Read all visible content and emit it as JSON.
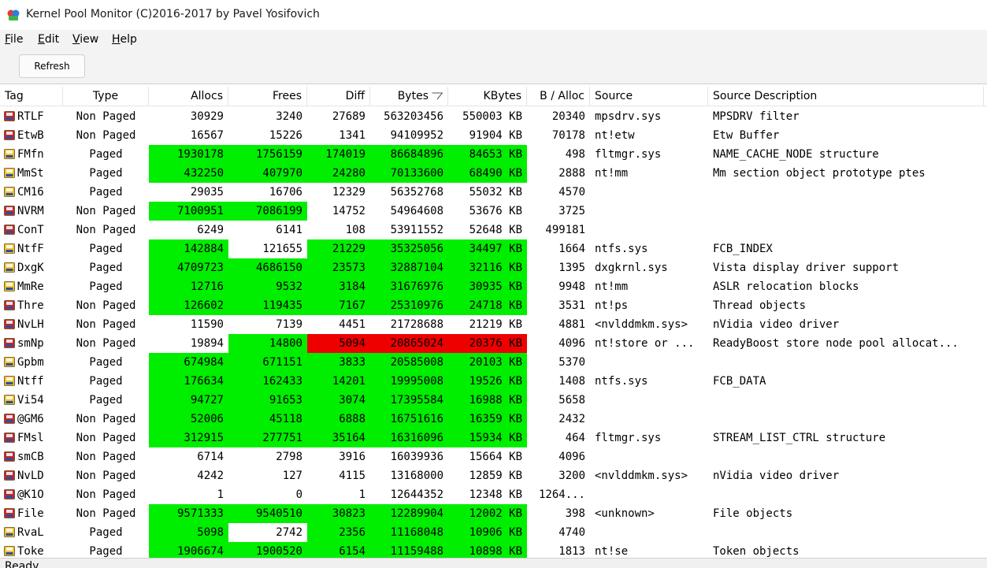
{
  "window": {
    "title": "Kernel Pool Monitor (C)2016-2017 by Pavel Yosifovich"
  },
  "menu": [
    {
      "label": "File",
      "mnemonic": "F",
      "rest": "ile"
    },
    {
      "label": "Edit",
      "mnemonic": "E",
      "rest": "dit"
    },
    {
      "label": "View",
      "mnemonic": "V",
      "rest": "iew"
    },
    {
      "label": "Help",
      "mnemonic": "H",
      "rest": "elp"
    }
  ],
  "toolbar": {
    "refresh_label": "Refresh"
  },
  "columns": [
    "Tag",
    "Type",
    "Allocs",
    "Frees",
    "Diff",
    "Bytes",
    "KBytes",
    "B / Alloc",
    "Source",
    "Source Description"
  ],
  "sorted_column": "Bytes",
  "colors": {
    "changed": "#00ee00",
    "decreased": "#ee0000",
    "paged_icon": "#f2c230",
    "nonpaged_icon": "#c0282d"
  },
  "rows": [
    {
      "tag": "RTLF",
      "type": "Non Paged",
      "allocs": "30929",
      "frees": "3240",
      "diff": "27689",
      "bytes": "563203456",
      "kbytes": "550003 KB",
      "balloc": "20340",
      "source": "mpsdrv.sys",
      "desc": "MPSDRV filter",
      "hl": []
    },
    {
      "tag": "EtwB",
      "type": "Non Paged",
      "allocs": "16567",
      "frees": "15226",
      "diff": "1341",
      "bytes": "94109952",
      "kbytes": "91904 KB",
      "balloc": "70178",
      "source": "nt!etw",
      "desc": "Etw Buffer",
      "hl": []
    },
    {
      "tag": "FMfn",
      "type": "Paged",
      "allocs": "1930178",
      "frees": "1756159",
      "diff": "174019",
      "bytes": "86684896",
      "kbytes": "84653 KB",
      "balloc": "498",
      "source": "fltmgr.sys",
      "desc": "NAME_CACHE_NODE structure",
      "hl": [
        "g",
        "g",
        "g",
        "g",
        "g"
      ]
    },
    {
      "tag": "MmSt",
      "type": "Paged",
      "allocs": "432250",
      "frees": "407970",
      "diff": "24280",
      "bytes": "70133600",
      "kbytes": "68490 KB",
      "balloc": "2888",
      "source": "nt!mm",
      "desc": "Mm section object prototype ptes",
      "hl": [
        "g",
        "g",
        "g",
        "g",
        "g"
      ]
    },
    {
      "tag": "CM16",
      "type": "Paged",
      "allocs": "29035",
      "frees": "16706",
      "diff": "12329",
      "bytes": "56352768",
      "kbytes": "55032 KB",
      "balloc": "4570",
      "source": "",
      "desc": "",
      "hl": []
    },
    {
      "tag": "NVRM",
      "type": "Non Paged",
      "allocs": "7100951",
      "frees": "7086199",
      "diff": "14752",
      "bytes": "54964608",
      "kbytes": "53676 KB",
      "balloc": "3725",
      "source": "",
      "desc": "",
      "hl": [
        "g",
        "g",
        "",
        "",
        ""
      ]
    },
    {
      "tag": "ConT",
      "type": "Non Paged",
      "allocs": "6249",
      "frees": "6141",
      "diff": "108",
      "bytes": "53911552",
      "kbytes": "52648 KB",
      "balloc": "499181",
      "source": "",
      "desc": "",
      "hl": []
    },
    {
      "tag": "NtfF",
      "type": "Paged",
      "allocs": "142884",
      "frees": "121655",
      "diff": "21229",
      "bytes": "35325056",
      "kbytes": "34497 KB",
      "balloc": "1664",
      "source": "ntfs.sys",
      "desc": "FCB_INDEX",
      "hl": [
        "g",
        "",
        "g",
        "g",
        "g"
      ]
    },
    {
      "tag": "DxgK",
      "type": "Paged",
      "allocs": "4709723",
      "frees": "4686150",
      "diff": "23573",
      "bytes": "32887104",
      "kbytes": "32116 KB",
      "balloc": "1395",
      "source": "dxgkrnl.sys",
      "desc": "Vista display driver support",
      "hl": [
        "g",
        "g",
        "g",
        "g",
        "g"
      ]
    },
    {
      "tag": "MmRe",
      "type": "Paged",
      "allocs": "12716",
      "frees": "9532",
      "diff": "3184",
      "bytes": "31676976",
      "kbytes": "30935 KB",
      "balloc": "9948",
      "source": "nt!mm",
      "desc": "ASLR relocation blocks",
      "hl": [
        "g",
        "g",
        "g",
        "g",
        "g"
      ]
    },
    {
      "tag": "Thre",
      "type": "Non Paged",
      "allocs": "126602",
      "frees": "119435",
      "diff": "7167",
      "bytes": "25310976",
      "kbytes": "24718 KB",
      "balloc": "3531",
      "source": "nt!ps",
      "desc": "Thread objects",
      "hl": [
        "g",
        "g",
        "g",
        "g",
        "g"
      ]
    },
    {
      "tag": "NvLH",
      "type": "Non Paged",
      "allocs": "11590",
      "frees": "7139",
      "diff": "4451",
      "bytes": "21728688",
      "kbytes": "21219 KB",
      "balloc": "4881",
      "source": "<nvlddmkm.sys>",
      "desc": "nVidia video driver",
      "hl": []
    },
    {
      "tag": "smNp",
      "type": "Non Paged",
      "allocs": "19894",
      "frees": "14800",
      "diff": "5094",
      "bytes": "20865024",
      "kbytes": "20376 KB",
      "balloc": "4096",
      "source": "nt!store or ...",
      "desc": "ReadyBoost store node pool allocat...",
      "hl": [
        "",
        "g",
        "r",
        "r",
        "r"
      ]
    },
    {
      "tag": "Gpbm",
      "type": "Paged",
      "allocs": "674984",
      "frees": "671151",
      "diff": "3833",
      "bytes": "20585008",
      "kbytes": "20103 KB",
      "balloc": "5370",
      "source": "",
      "desc": "",
      "hl": [
        "g",
        "g",
        "g",
        "g",
        "g"
      ]
    },
    {
      "tag": "Ntff",
      "type": "Paged",
      "allocs": "176634",
      "frees": "162433",
      "diff": "14201",
      "bytes": "19995008",
      "kbytes": "19526 KB",
      "balloc": "1408",
      "source": "ntfs.sys",
      "desc": "FCB_DATA",
      "hl": [
        "g",
        "g",
        "g",
        "g",
        "g"
      ]
    },
    {
      "tag": "Vi54",
      "type": "Paged",
      "allocs": "94727",
      "frees": "91653",
      "diff": "3074",
      "bytes": "17395584",
      "kbytes": "16988 KB",
      "balloc": "5658",
      "source": "",
      "desc": "",
      "hl": [
        "g",
        "g",
        "g",
        "g",
        "g"
      ]
    },
    {
      "tag": "@GM6",
      "type": "Non Paged",
      "allocs": "52006",
      "frees": "45118",
      "diff": "6888",
      "bytes": "16751616",
      "kbytes": "16359 KB",
      "balloc": "2432",
      "source": "",
      "desc": "",
      "hl": [
        "g",
        "g",
        "g",
        "g",
        "g"
      ]
    },
    {
      "tag": "FMsl",
      "type": "Non Paged",
      "allocs": "312915",
      "frees": "277751",
      "diff": "35164",
      "bytes": "16316096",
      "kbytes": "15934 KB",
      "balloc": "464",
      "source": "fltmgr.sys",
      "desc": "STREAM_LIST_CTRL structure",
      "hl": [
        "g",
        "g",
        "g",
        "g",
        "g"
      ]
    },
    {
      "tag": "smCB",
      "type": "Non Paged",
      "allocs": "6714",
      "frees": "2798",
      "diff": "3916",
      "bytes": "16039936",
      "kbytes": "15664 KB",
      "balloc": "4096",
      "source": "",
      "desc": "",
      "hl": []
    },
    {
      "tag": "NvLD",
      "type": "Non Paged",
      "allocs": "4242",
      "frees": "127",
      "diff": "4115",
      "bytes": "13168000",
      "kbytes": "12859 KB",
      "balloc": "3200",
      "source": "<nvlddmkm.sys>",
      "desc": "nVidia video driver",
      "hl": []
    },
    {
      "tag": "@K1O",
      "type": "Non Paged",
      "allocs": "1",
      "frees": "0",
      "diff": "1",
      "bytes": "12644352",
      "kbytes": "12348 KB",
      "balloc": "1264...",
      "source": "",
      "desc": "",
      "hl": []
    },
    {
      "tag": "File",
      "type": "Non Paged",
      "allocs": "9571333",
      "frees": "9540510",
      "diff": "30823",
      "bytes": "12289904",
      "kbytes": "12002 KB",
      "balloc": "398",
      "source": "<unknown>",
      "desc": "File objects",
      "hl": [
        "g",
        "g",
        "g",
        "g",
        "g"
      ]
    },
    {
      "tag": "RvaL",
      "type": "Paged",
      "allocs": "5098",
      "frees": "2742",
      "diff": "2356",
      "bytes": "11168048",
      "kbytes": "10906 KB",
      "balloc": "4740",
      "source": "",
      "desc": "",
      "hl": [
        "g",
        "",
        "g",
        "g",
        "g"
      ]
    },
    {
      "tag": "Toke",
      "type": "Paged",
      "allocs": "1906674",
      "frees": "1900520",
      "diff": "6154",
      "bytes": "11159488",
      "kbytes": "10898 KB",
      "balloc": "1813",
      "source": "nt!se",
      "desc": "Token objects",
      "hl": [
        "g",
        "g",
        "g",
        "g",
        "g"
      ]
    }
  ],
  "status": {
    "text": "Ready"
  }
}
